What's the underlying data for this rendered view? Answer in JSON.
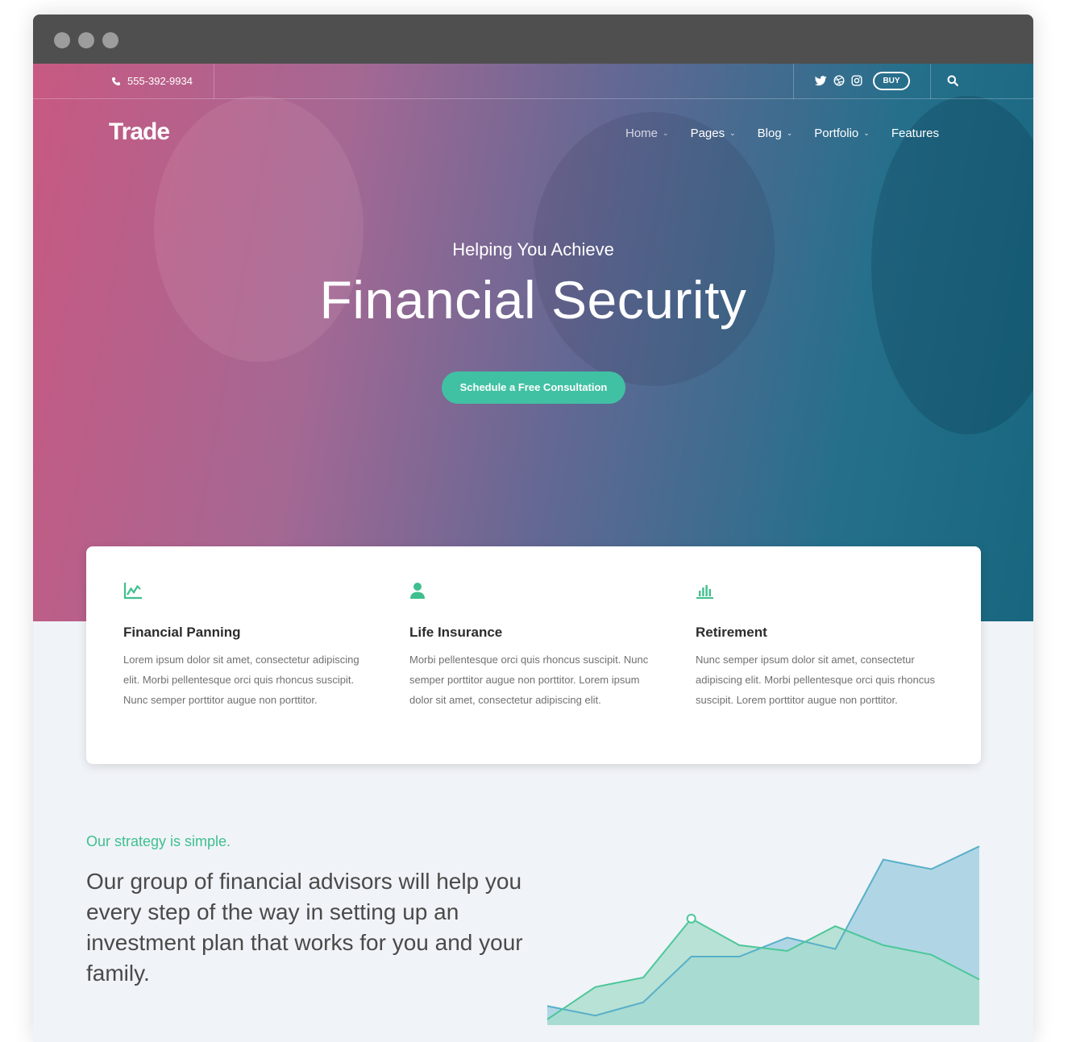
{
  "topbar": {
    "phone": "555-392-9934",
    "social_icons": [
      "twitter-icon",
      "dribbble-icon",
      "instagram-icon"
    ],
    "buy_label": "BUY"
  },
  "header": {
    "logo": "Trade",
    "nav": [
      {
        "label": "Home",
        "has_dropdown": true
      },
      {
        "label": "Pages",
        "has_dropdown": true
      },
      {
        "label": "Blog",
        "has_dropdown": true
      },
      {
        "label": "Portfolio",
        "has_dropdown": true
      },
      {
        "label": "Features",
        "has_dropdown": false
      }
    ]
  },
  "hero": {
    "subtitle": "Helping You Achieve",
    "title": "Financial Security",
    "cta_label": "Schedule a Free Consultation"
  },
  "features": [
    {
      "icon": "line-chart-icon",
      "title": "Financial Panning",
      "text": "Lorem ipsum dolor sit amet, consectetur adipiscing elit. Morbi pellentesque orci quis rhoncus suscipit. Nunc semper porttitor augue non porttitor."
    },
    {
      "icon": "user-icon",
      "title": "Life Insurance",
      "text": "Morbi pellentesque orci quis rhoncus suscipit. Nunc semper porttitor augue non porttitor. Lorem ipsum dolor sit amet, consectetur adipiscing elit."
    },
    {
      "icon": "bar-chart-icon",
      "title": "Retirement",
      "text": "Nunc semper ipsum dolor sit amet, consectetur adipiscing elit. Morbi pellentesque orci quis rhoncus suscipit.  Lorem porttitor augue non porttitor."
    }
  ],
  "strategy": {
    "kicker": "Our strategy is simple.",
    "text": "Our group of financial advisors will help you every step of the way in setting up an investment plan that works for you and your family."
  },
  "colors": {
    "accent": "#41c1a3",
    "kicker": "#3fbf8e",
    "area_blue": "#a9d3e2",
    "area_green": "#a6dcca",
    "line_blue": "#58afc9",
    "line_green": "#4cc79a"
  },
  "chart_data": {
    "type": "area",
    "x": [
      0,
      1,
      2,
      3,
      4,
      5,
      6,
      7,
      8,
      9
    ],
    "series": [
      {
        "values": [
          10,
          5,
          12,
          36,
          36,
          46,
          40,
          87,
          82,
          94
        ]
      },
      {
        "values": [
          3,
          20,
          25,
          56,
          42,
          39,
          52,
          42,
          37,
          24
        ]
      }
    ],
    "ylim": [
      0,
      100
    ],
    "highlight": {
      "series": 1,
      "index": 3
    }
  }
}
